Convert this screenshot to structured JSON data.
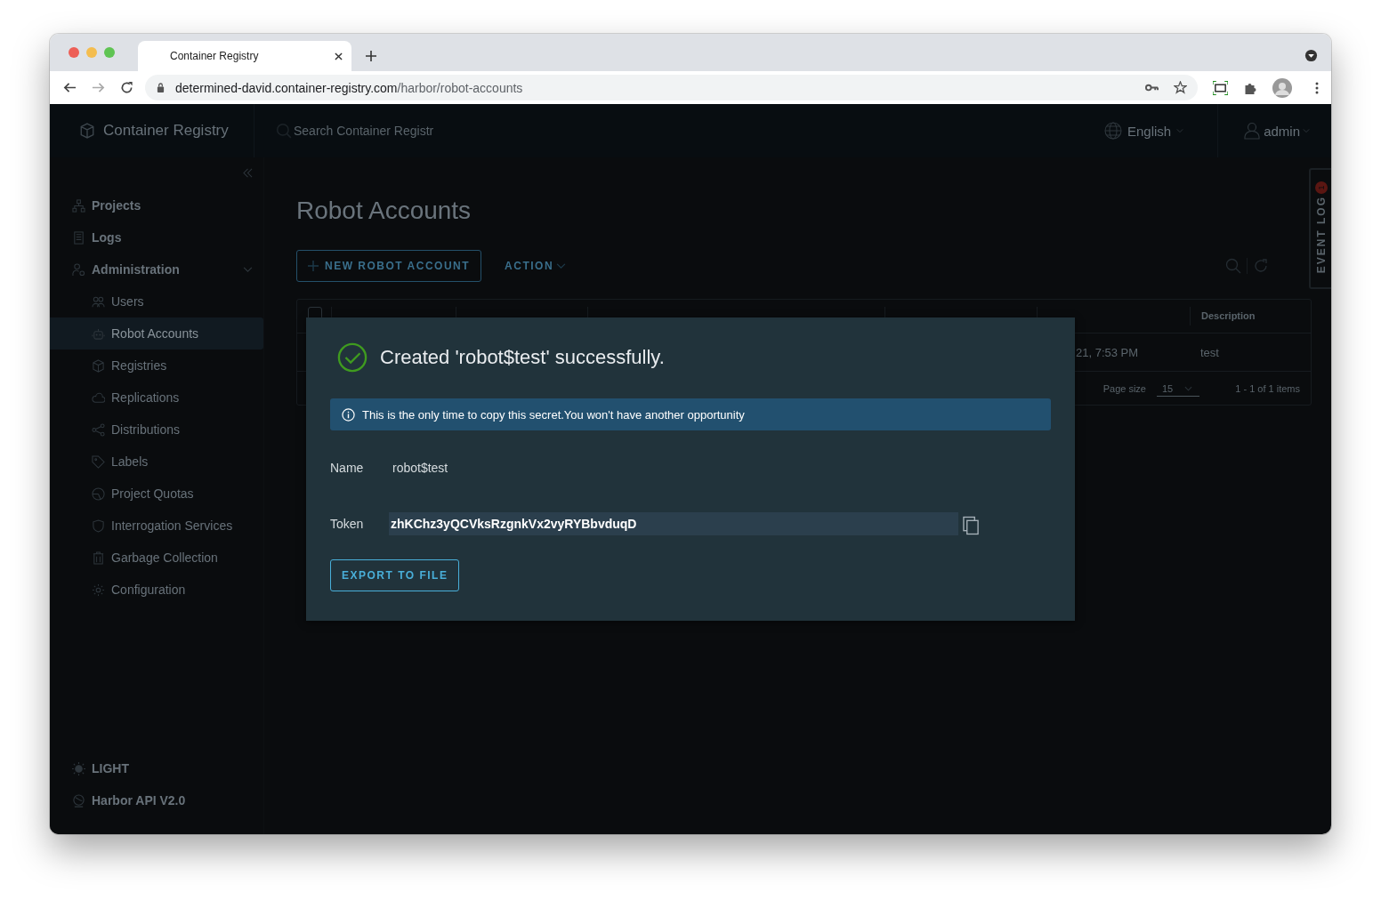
{
  "browser": {
    "tab_title": "Container Registry",
    "url_host": "determined-david.container-registry.com",
    "url_path": "/harbor/robot-accounts"
  },
  "header": {
    "brand": "Container Registry",
    "search_placeholder": "Search Container Registr",
    "language": "English",
    "user": "admin"
  },
  "sidebar": {
    "items": [
      {
        "label": "Projects",
        "selected": false
      },
      {
        "label": "Logs",
        "selected": false
      },
      {
        "label": "Administration",
        "selected": false,
        "expanded": true,
        "children": [
          {
            "label": "Users",
            "selected": false
          },
          {
            "label": "Robot Accounts",
            "selected": true
          },
          {
            "label": "Registries",
            "selected": false
          },
          {
            "label": "Replications",
            "selected": false
          },
          {
            "label": "Distributions",
            "selected": false
          },
          {
            "label": "Labels",
            "selected": false
          },
          {
            "label": "Project Quotas",
            "selected": false
          },
          {
            "label": "Interrogation Services",
            "selected": false
          },
          {
            "label": "Garbage Collection",
            "selected": false
          },
          {
            "label": "Configuration",
            "selected": false
          }
        ]
      }
    ],
    "footer": [
      "LIGHT",
      "Harbor API V2.0"
    ]
  },
  "page": {
    "title": "Robot Accounts",
    "new_button": "NEW ROBOT ACCOUNT",
    "action_button": "ACTION",
    "table": {
      "select_all_checked": false,
      "columns": [
        "Description"
      ],
      "rows": [
        {
          "expires_at": "21, 7:53 PM",
          "description": "test"
        }
      ],
      "page_size_label": "Page size",
      "page_size": "15",
      "range": "1 - 1 of 1 items"
    }
  },
  "event_log": {
    "label": "EVENT LOG",
    "badge": "1"
  },
  "modal": {
    "title": "Created 'robot$test' successfully.",
    "alert": "This is the only time to copy this secret.You won't have another opportunity",
    "fields": [
      {
        "label": "Name",
        "value": "robot$test",
        "kind": "text"
      },
      {
        "label": "Token",
        "value": "zhKChz3yQCVksRzgnkVx2vyRYBbvduqD",
        "kind": "secret"
      }
    ],
    "button": "EXPORT TO FILE"
  }
}
